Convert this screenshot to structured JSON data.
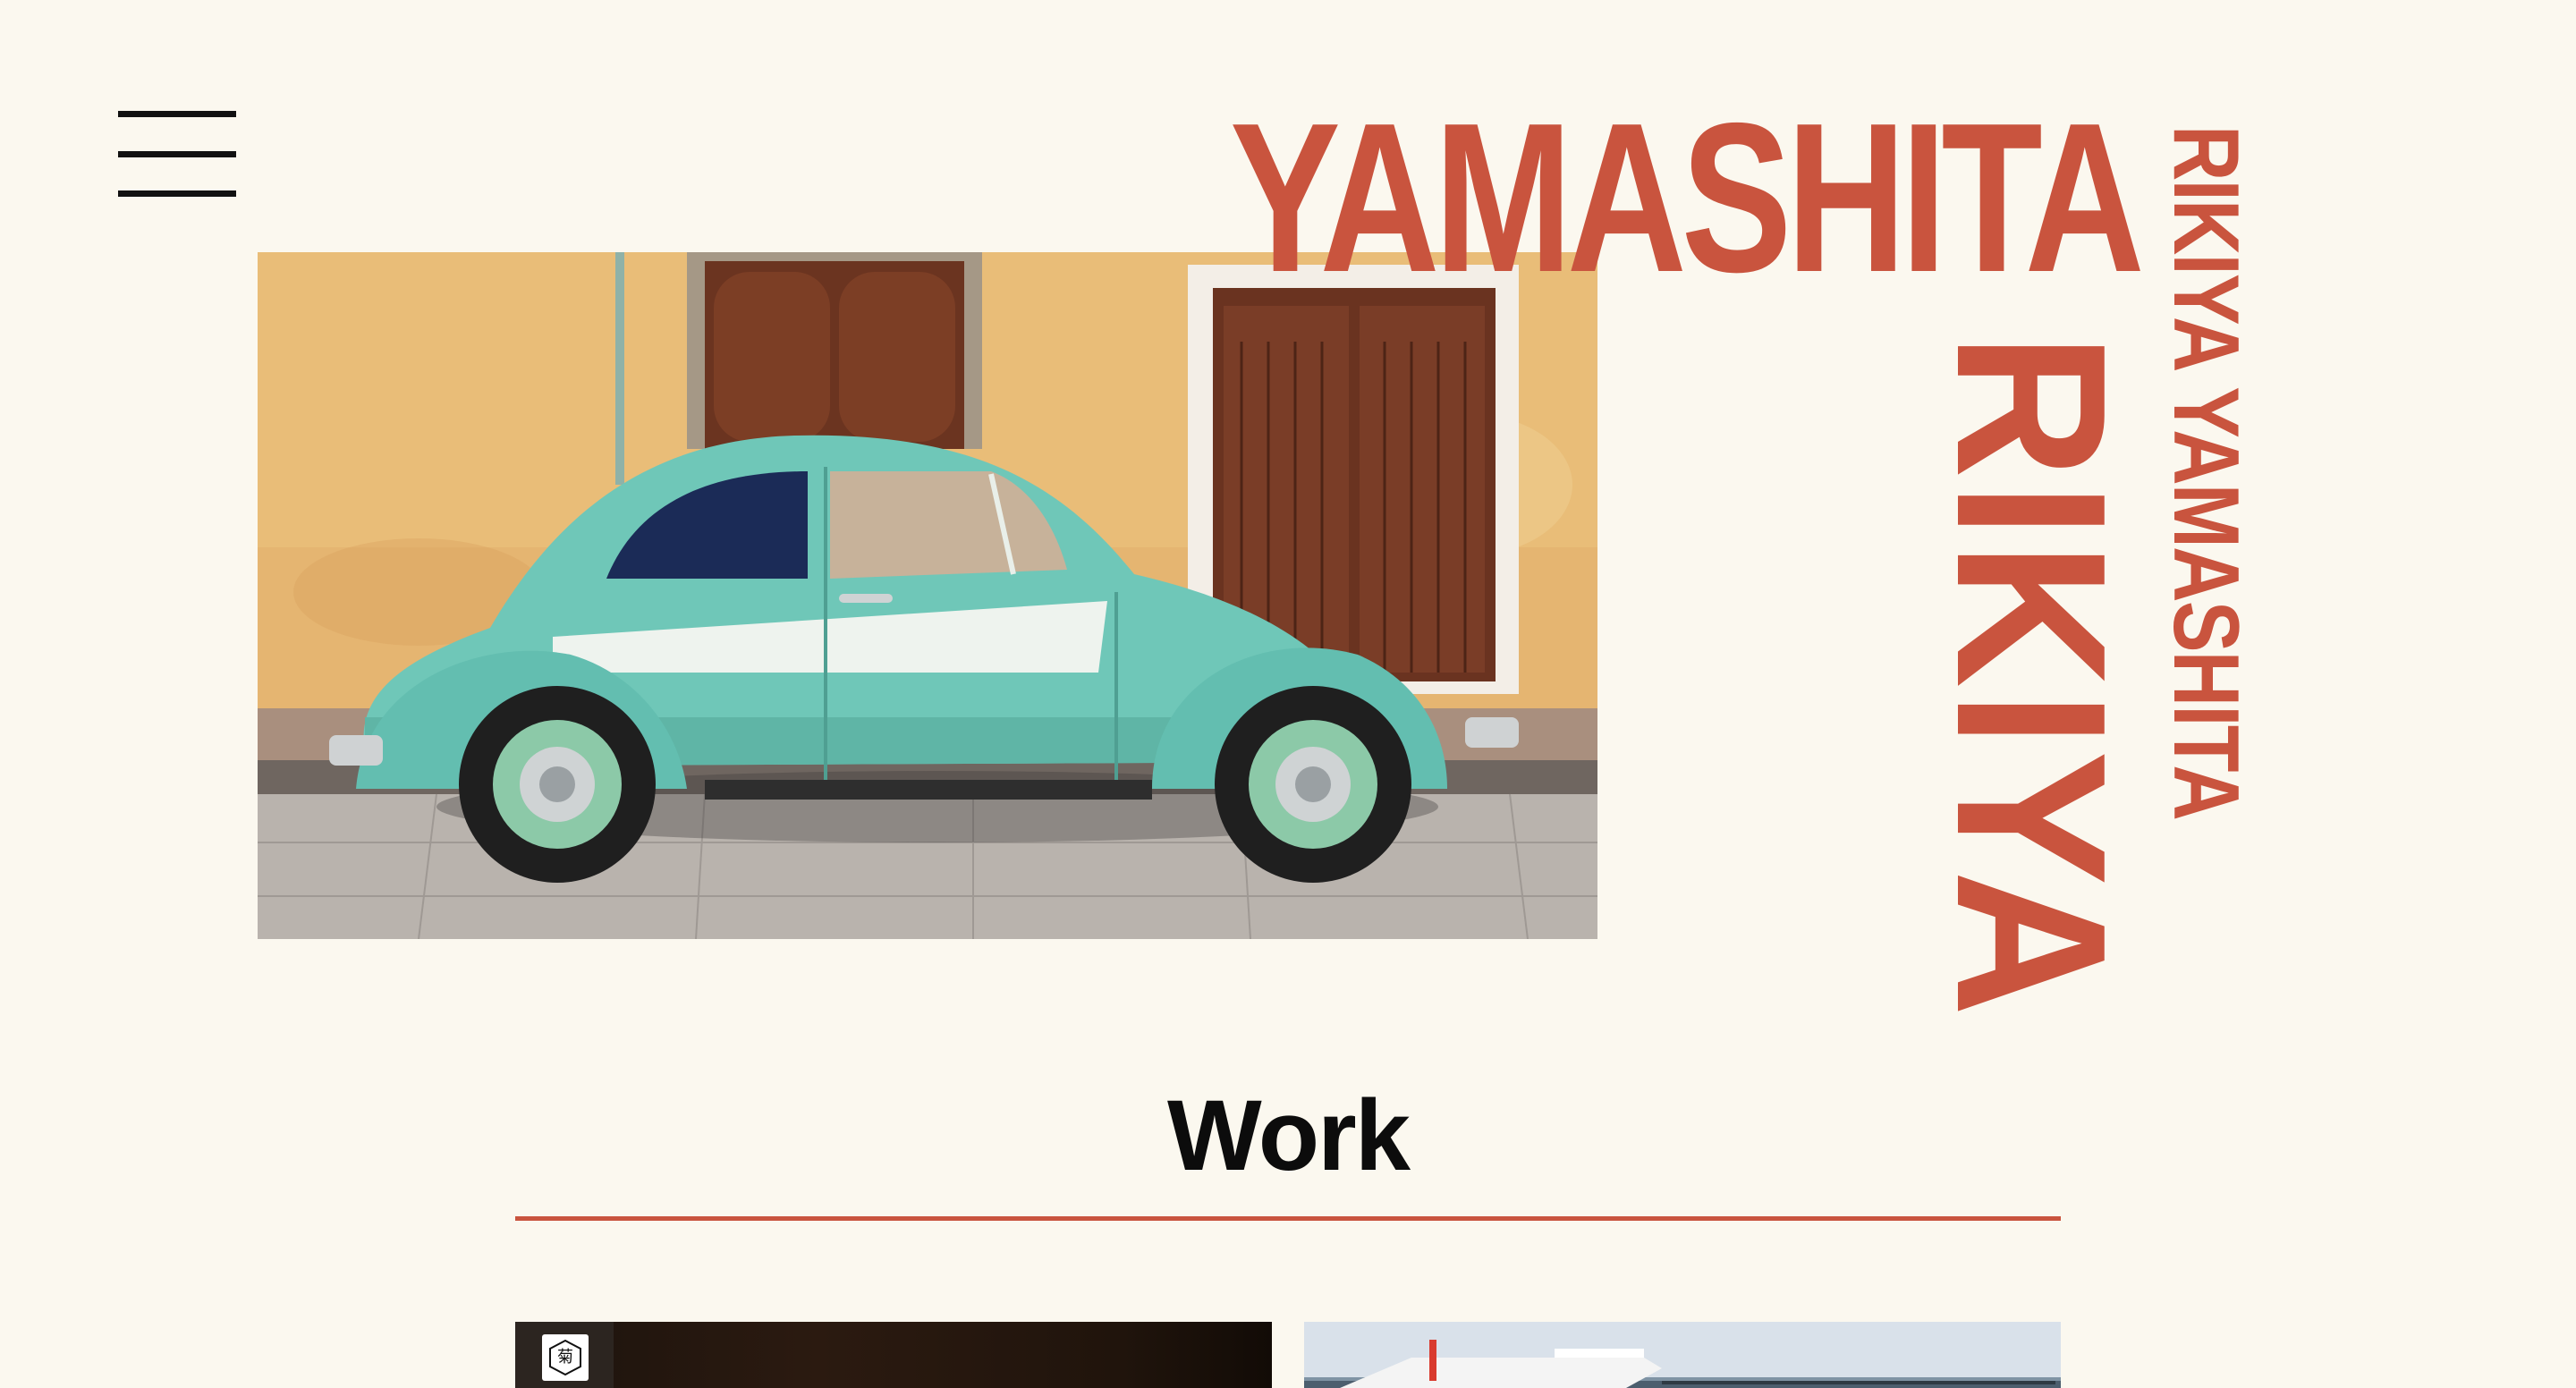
{
  "header": {
    "menu_icon": "hamburger-menu-icon"
  },
  "hero": {
    "photo_subject": "vintage-car-photo",
    "name_horizontal": "YAMASHITA",
    "name_vertical": "RIKIYA",
    "name_vertical_full": "RIKIYA YAMASHITA"
  },
  "work": {
    "heading": "Work",
    "items": [
      {
        "id": "work-1",
        "badge_glyph": "菊",
        "image": "dark-stage-photo"
      },
      {
        "id": "work-2",
        "image": "boat-on-water-photo"
      }
    ]
  },
  "colors": {
    "background": "#fbf8ef",
    "accent": "#c9543e",
    "text": "#0c0c0c"
  }
}
